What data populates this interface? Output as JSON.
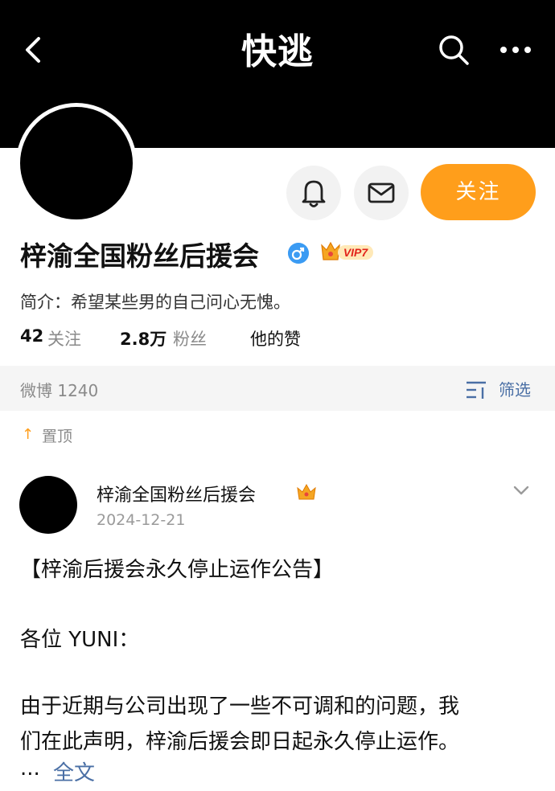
{
  "header": {
    "title": "快逃",
    "back_icon": "chevron-left-icon",
    "search_icon": "search-icon",
    "more_icon": "more-icon"
  },
  "actions": {
    "bell_icon": "bell-icon",
    "message_icon": "mail-icon",
    "follow_label": "关注",
    "follow_color": "#ff9e1b"
  },
  "profile": {
    "name": "梓渝全国粉丝后援会",
    "gender_icon": "male-icon",
    "vip_label": "VIP7",
    "bio": "简介：希望某些男的自己问心无愧。",
    "stats": {
      "following_count": "42",
      "following_label": "关注",
      "followers_count": "2.8万",
      "followers_label": "粉丝",
      "likes_label": "他的赞"
    }
  },
  "weibo_bar": {
    "count_label": "微博 1240",
    "filter_label": "筛选",
    "filter_icon": "filter-icon"
  },
  "pinned": {
    "icon": "↑",
    "label": "置顶"
  },
  "post": {
    "author": "梓渝全国粉丝后援会",
    "date": "2024-12-21",
    "title": "【梓渝后援会永久停止运作公告】",
    "greeting": "各位 YUNI：",
    "body_line1": "由于近期与公司出现了一些不可调和的问题，我",
    "body_line2": "们在此声明，梓渝后援会即日起永久停止运作。",
    "ellipsis": "...",
    "full_text_label": "全文"
  },
  "colors": {
    "header_bg": "#000000",
    "accent": "#ff9e1b",
    "link": "#4a6fa5",
    "verified_blue": "#3b9bf3"
  }
}
